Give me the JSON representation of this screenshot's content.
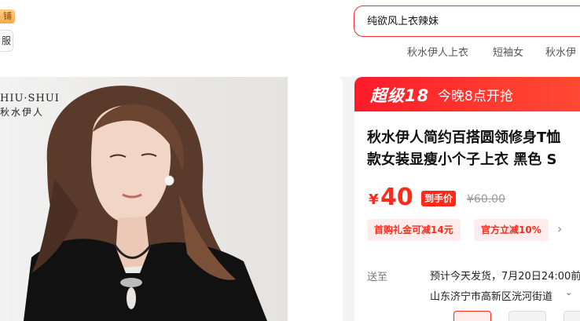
{
  "header": {
    "shop_tag": "铺",
    "shop_button": "服"
  },
  "search": {
    "value": "纯欲风上衣辣妹",
    "hot_words": [
      "秋水伊人上衣",
      "短袖女",
      "秋水伊"
    ]
  },
  "gallery": {
    "brand_en": "HIU·SHUI",
    "brand_cn": "秋水伊人"
  },
  "promo": {
    "brand": "超级18",
    "text": "今晚8点开抢"
  },
  "product": {
    "title_line1": "秋水伊人简约百搭圆领修身T恤",
    "title_line2": "款女装显瘦小个子上衣 黑色 S",
    "currency": "¥",
    "price": "40",
    "price_tag": "到手价",
    "original_price": "¥60.00",
    "coupons": [
      "首购礼金可减14元",
      "官方立减10%"
    ]
  },
  "delivery": {
    "label": "送至",
    "ship_text": "预计今天发货，7月20日24:00前",
    "address": "山东济宁市高新区洸河街道"
  },
  "colors": {
    "accent": "#ff2a1a",
    "promo_bg": "#ff1a2a"
  }
}
